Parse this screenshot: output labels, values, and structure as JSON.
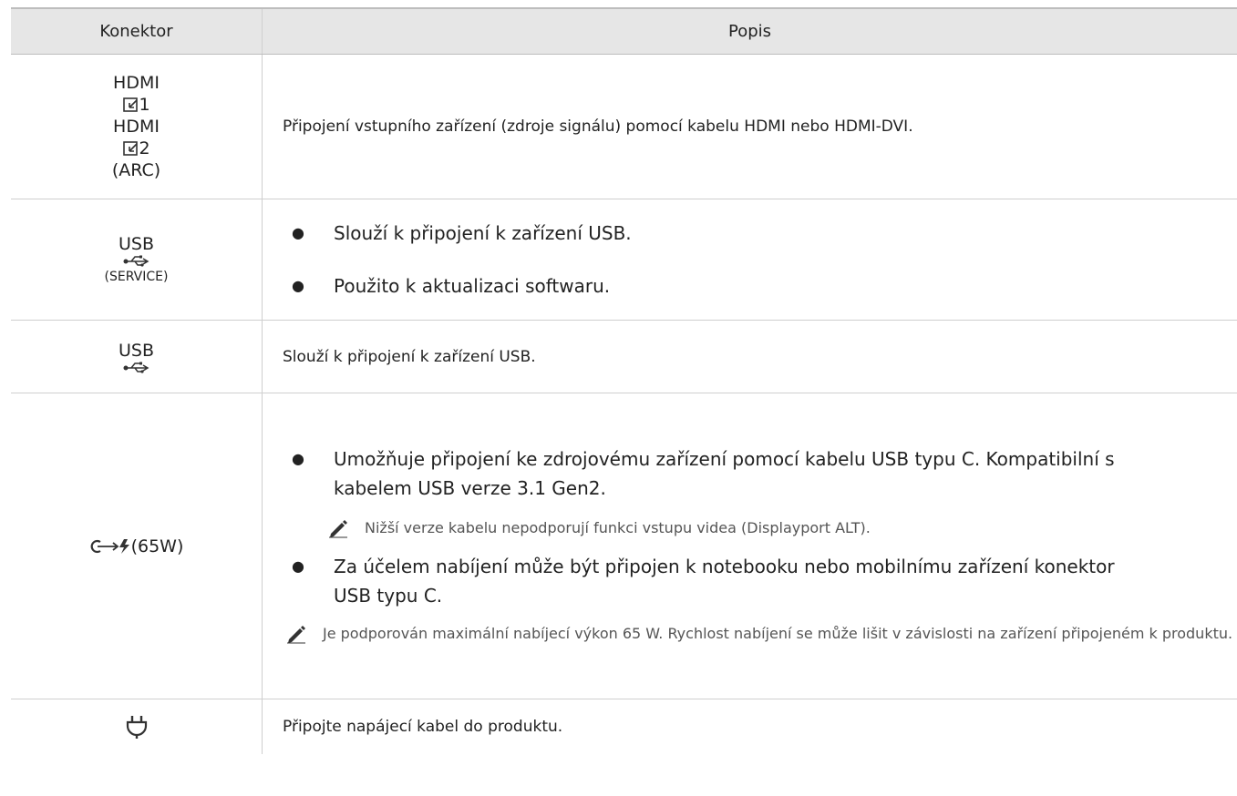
{
  "header": {
    "col1": "Konektor",
    "col2": "Popis"
  },
  "rows": [
    {
      "connector": {
        "line1": "HDMI",
        "line2": "1",
        "line3": "HDMI",
        "line4": "2",
        "line5": "(ARC)"
      },
      "description": "Připojení vstupního zařízení (zdroje signálu) pomocí kabelu HDMI nebo HDMI-DVI."
    },
    {
      "connector": {
        "line1": "USB",
        "line3": "(SERVICE)"
      },
      "bullets": [
        "Slouží k připojení k zařízení USB.",
        "Použito k aktualizaci softwaru."
      ]
    },
    {
      "connector": {
        "line1": "USB"
      },
      "description": "Slouží k připojení k zařízení USB."
    },
    {
      "connector": {
        "label": "(65W)"
      },
      "bullet1": "Umožňuje připojení ke zdrojovému zařízení pomocí kabelu USB typu C. Kompatibilní s kabelem USB verze 3.1 Gen2.",
      "note1": "Nižší verze kabelu nepodporují funkci vstupu videa (Displayport ALT).",
      "bullet2": "Za účelem nabíjení může být připojen k notebooku nebo mobilnímu zařízení konektor USB typu C.",
      "note2": "Je podporován maximální nabíjecí výkon 65 W. Rychlost nabíjení se může lišit v závislosti na zařízení připojeném k produktu."
    },
    {
      "description": "Připojte napájecí kabel do produktu."
    }
  ],
  "icons": {
    "hdmi": "input-icon",
    "usb": "usb-icon",
    "usbc": "usb-c-power-icon",
    "power": "power-plug-icon",
    "note": "pencil-note-icon"
  }
}
